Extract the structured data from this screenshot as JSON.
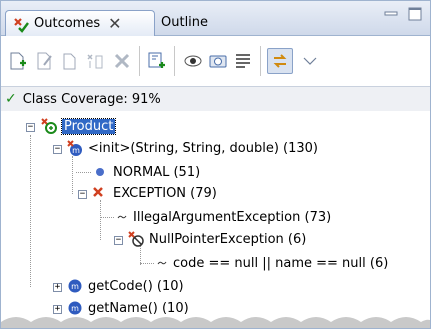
{
  "tabs": {
    "active_label": "Outcomes",
    "inactive_label": "Outline",
    "close_glyph": "✕"
  },
  "toolbar": {
    "buttons": [
      "new-outcome-icon",
      "edit-icon",
      "copy-icon",
      "find-icon",
      "delete-icon",
      "add-test-icon",
      "view-icon",
      "camera-icon",
      "list-icon",
      "sync-icon",
      "view-menu-icon"
    ]
  },
  "status": {
    "check": "✓",
    "text": "Class Coverage: 91%"
  },
  "tree": {
    "root": "Product",
    "init": "<init>(String, String, double) (130)",
    "normal": "NORMAL (51)",
    "exception": "EXCEPTION (79)",
    "illegal": "IllegalArgumentException (73)",
    "nullptr": "NullPointerException (6)",
    "condition": "code == null || name == null (6)",
    "getcode": "getCode() (10)",
    "getname": "getName() (10)"
  },
  "colors": {
    "selection": "#3169c6",
    "method_icon": "#2f5bbf",
    "exception_x": "#d04020",
    "success_green": "#1a8a1a"
  }
}
